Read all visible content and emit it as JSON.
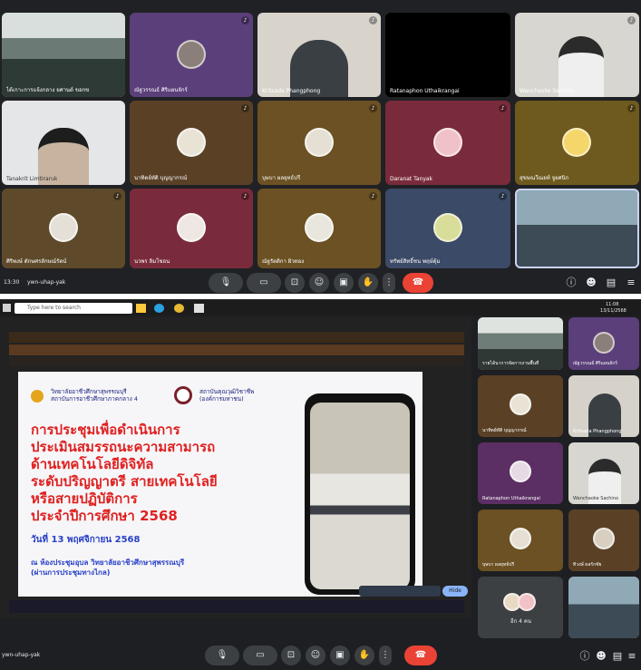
{
  "top_call": {
    "time": "13:30",
    "meeting_code": "ywn-uhap-yak",
    "participants": [
      {
        "name": "ได้เกาะการแจ้งกลาง ยศานต์ ขอกข",
        "has_mic": false
      },
      {
        "name": "ณัฐวรรณธ์ ศิริแผนจักร์",
        "has_mic": true
      },
      {
        "name": "Kritsada Phangphong",
        "has_mic": true
      },
      {
        "name": "Ratanaphon Uthaikrangai",
        "has_mic": false
      },
      {
        "name": "Wanchaoke Sachino",
        "has_mic": true
      },
      {
        "name": "Tanakrit Limtiraruk",
        "has_mic": false
      },
      {
        "name": "นาทิตย์ทัติ บุญญากรณ์",
        "has_mic": true
      },
      {
        "name": "บุษบา ผลยุทธ์ปรี",
        "has_mic": true
      },
      {
        "name": "Daranat Tanyak",
        "has_mic": true
      },
      {
        "name": "สุขษณวีณยท์ จูยศนิก",
        "has_mic": true
      },
      {
        "name": "ศิริพงษ์ ตักษศรลักษณ์รัตน์",
        "has_mic": true
      },
      {
        "name": "นวพร ลิมโชอน",
        "has_mic": true
      },
      {
        "name": "ณัฐรัตติกา ผิวทอง",
        "has_mic": true
      },
      {
        "name": "ทรัพย์สิทธิ์ชน พฤษ์ตุ้ม",
        "has_mic": true
      },
      {
        "name": "",
        "has_mic": false
      }
    ]
  },
  "bottom_call": {
    "meeting_code": "ywn-uhap-yak",
    "taskbar": {
      "search_placeholder": "Type here to search",
      "time": "11:08",
      "date": "13/11/2568"
    },
    "slide": {
      "org_left_line1": "วิทยาลัยอาชีวศึกษาสุพรรณบุรี",
      "org_left_line2": "สถาบันการอาชีวศึกษาภาคกลาง 4",
      "org_right_line1": "สถาบันคุณวุฒิวิชาชีพ",
      "org_right_line2": "(องค์การมหาชน)",
      "title_lines": [
        "การประชุมเพื่อดำเนินการ",
        "ประเมินสมรรถนะความสามารถ",
        "ด้านเทคโนโลยีดิจิทัล",
        "ระดับปริญญาตรี สายเทคโนโลยี",
        "หรือสายปฏิบัติการ",
        "ประจำปีการศึกษา 2568"
      ],
      "date_line": "วันที่ 13 พฤศจิกายน 2568",
      "place_line1": "ณ ห้องประชุมอุบล วิทยาลัยอาชีวศึกษาสุพรรณบุรี",
      "place_line2": "(ผ่านการประชุมทางไกล)"
    },
    "side_participants": [
      {
        "name": "รายได้นาการจัดการงานพื้นที่"
      },
      {
        "name": "ณัฐวรรณธ์ ศิริแผนจักร์"
      },
      {
        "name": "นาทิตย์ทัติ บุญญากรณ์"
      },
      {
        "name": "Kritsada Phangphong"
      },
      {
        "name": "Ratanaphon Uthaikrangai"
      },
      {
        "name": "Wanchaoke Sachino"
      },
      {
        "name": "บุษบา ผลยุทธ์ปรี"
      },
      {
        "name": "ทิวงษ์ ผลรักชัย"
      },
      {
        "name": "อีก 4 คน"
      },
      {
        "name": ""
      }
    ],
    "hide_button": "Hide"
  },
  "colors": {
    "call_bg": "#202124",
    "tile_purple": "#5b3f7a",
    "tile_brown": "#5a4126",
    "tile_red": "#7a2b3b",
    "tile_olive": "#6e5a1e",
    "tile_blue": "#3b4a66",
    "end_call": "#ea4335",
    "slide_red": "#e02020",
    "slide_blue": "#2840c8"
  }
}
